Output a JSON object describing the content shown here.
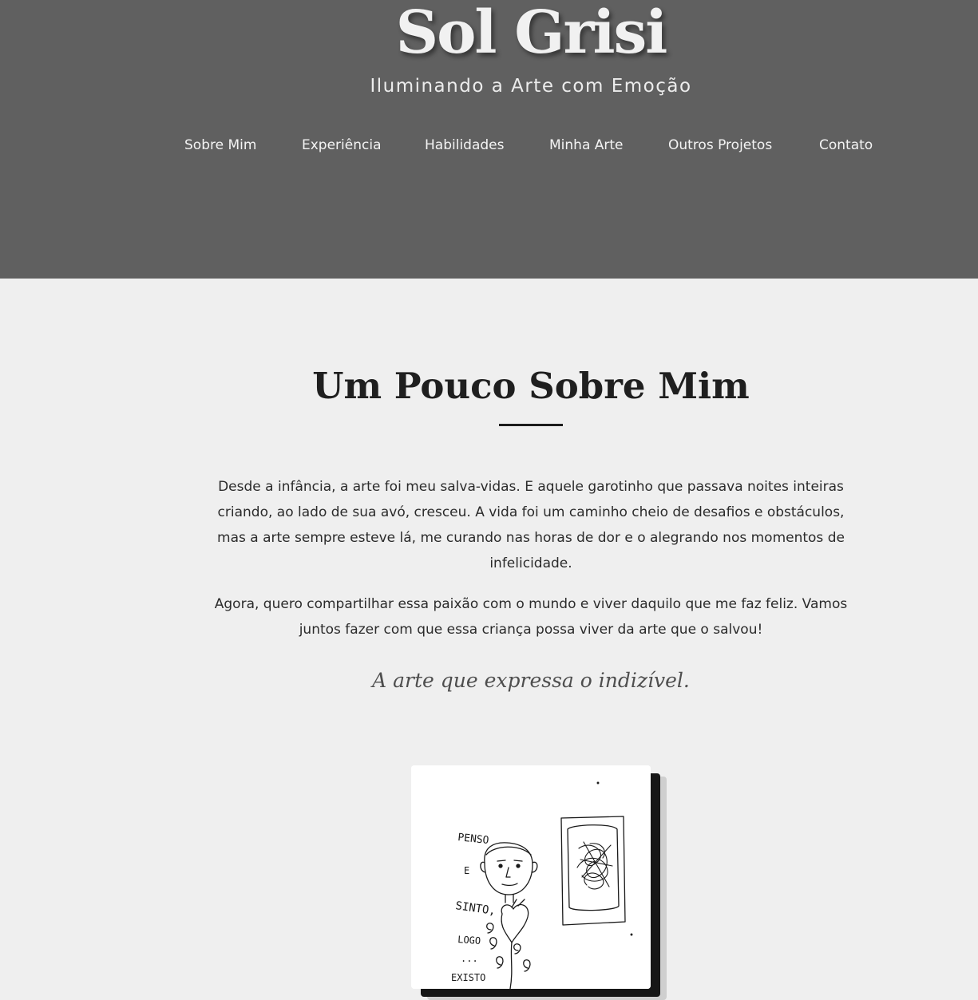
{
  "header": {
    "title": "Sol Grisi",
    "tagline": "Iluminando a Arte com Emoção",
    "background": "#606060"
  },
  "nav": {
    "items": [
      {
        "label": "Sobre Mim"
      },
      {
        "label": "Experiência"
      },
      {
        "label": "Habilidades"
      },
      {
        "label": "Minha Arte"
      },
      {
        "label": "Outros Projetos"
      },
      {
        "label": "Contato"
      }
    ]
  },
  "about": {
    "heading": "Um Pouco Sobre Mim",
    "paragraphs": [
      "Desde a infância, a arte foi meu salva-vidas. E aquele garotinho que passava noites inteiras criando, ao lado de sua avó, cresceu. A vida foi um caminho cheio de desafios e obstáculos, mas a arte sempre esteve lá, me curando nas horas de dor e o alegrando nos momentos de infelicidade.",
      "Agora, quero compartilhar essa paixão com o mundo e viver daquilo que me faz feliz. Vamos juntos fazer com que essa criança possa viver da arte que o salvou!"
    ],
    "quote": "A arte que expressa o indizível."
  },
  "artwork": {
    "subject": "hand-drawn sketch of a face, heart and scribbled frame",
    "handwriting": [
      "PENSO",
      "E",
      "SINTO,",
      "LOGO",
      "...",
      "EXISTO"
    ]
  }
}
